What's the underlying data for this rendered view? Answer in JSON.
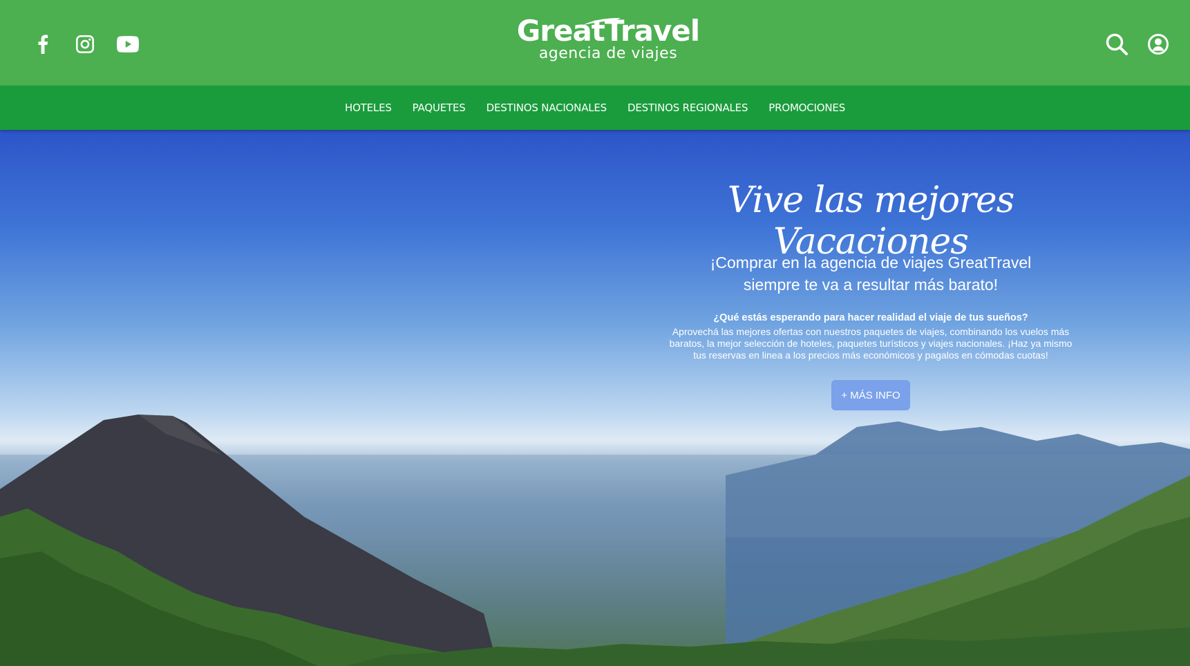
{
  "header": {
    "logo_text": "GreatTravel",
    "logo_tagline": "agencia de viajes",
    "bg_color": "#4caf50",
    "nav_bg_color": "#1a9c3c"
  },
  "social": [
    {
      "icon": "facebook-icon"
    },
    {
      "icon": "instagram-icon"
    },
    {
      "icon": "youtube-icon"
    }
  ],
  "header_icons": [
    {
      "icon": "search-icon"
    },
    {
      "icon": "user-account-icon"
    }
  ],
  "nav": {
    "items": [
      "HOTELES",
      "PAQUETES",
      "DESTINOS NACIONALES",
      "DESTINOS REGIONALES",
      "PROMOCIONES"
    ]
  },
  "hero": {
    "title": "Vive las mejores Vacaciones",
    "subtitle_line1": "¡Comprar en la agencia de viajes GreatTravel",
    "subtitle_line2": "siempre te va a resultar más barato!",
    "question": "¿Qué estás esperando para hacer realidad el viaje de tus sueños?",
    "body": "Aprovechá las mejores ofertas con nuestros paquetes de viajes, combinando los vuelos más baratos, la mejor selección de hoteles, paquetes turísticos y viajes nacionales. ¡Haz ya mismo tus reservas en linea a los precios más económicos y pagalos en cómodas cuotas!",
    "cta_label": "+ MÁS INFO",
    "cta_color": "#7aa1ea"
  }
}
